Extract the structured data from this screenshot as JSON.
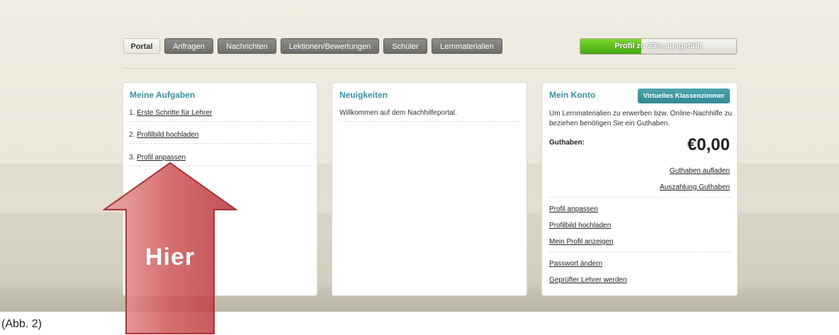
{
  "tabs": [
    {
      "label": "Portal",
      "active": true
    },
    {
      "label": "Anfragen"
    },
    {
      "label": "Nachrichten"
    },
    {
      "label": "Lektionen/Bewertungen"
    },
    {
      "label": "Schüler"
    },
    {
      "label": "Lernmaterialien"
    }
  ],
  "profile_progress": {
    "label": "Profil zu 39% ausgefüllt",
    "percent": 39
  },
  "tasks_panel": {
    "title": "Meine Aufgaben",
    "items": [
      {
        "num": "1.",
        "text": "Erste Schritte für Lehrer"
      },
      {
        "num": "2.",
        "text": "Profilbild hochladen"
      },
      {
        "num": "3.",
        "text": "Profil anpassen"
      }
    ]
  },
  "news_panel": {
    "title": "Neuigkeiten",
    "items": [
      "Willkommen auf dem Nachhilfeportal."
    ]
  },
  "account_panel": {
    "title": "Mein Konto",
    "virtual_classroom_button": "Virtuelles Klassenzimmer",
    "description": "Um Lernmaterialien zu erwerben bzw. Online-Nachhilfe zu beziehen benötigen Sie ein Guthaben.",
    "balance_label": "Guthaben:",
    "balance_value": "€0,00",
    "topup_link": "Guthaben aufladen",
    "payout_link": "Auszahlung Guthaben",
    "links": [
      "Profil anpassen",
      "Profilbild hochladen",
      "Mein Profil anzeigen",
      "Passwort ändern",
      "Geprüfter Lehrer werden"
    ]
  },
  "annotation": {
    "arrow_label": "Hier",
    "color": "#c9484a"
  },
  "caption": "(Abb. 2)"
}
